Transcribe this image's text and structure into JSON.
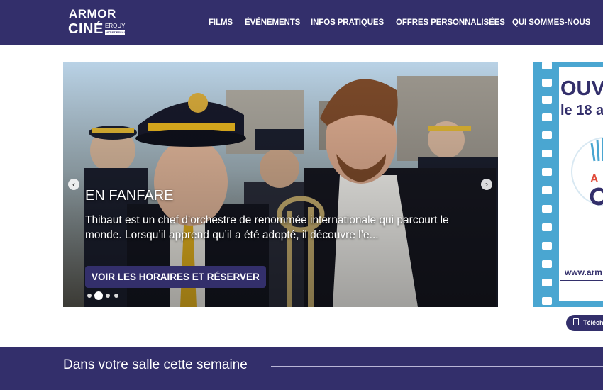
{
  "header": {
    "logo": {
      "line1": "ARMOR",
      "line2": "CINÉ",
      "line3": "ERQUY",
      "line4": "ART ET ESSAI"
    },
    "nav": [
      {
        "label": "FILMS"
      },
      {
        "label": "ÉVÉNEMENTS"
      },
      {
        "label": "INFOS PRATIQUES"
      },
      {
        "label": "OFFRES PERSONNALISÉES"
      },
      {
        "label": "QUI SOMMES-NOUS"
      }
    ],
    "colors": {
      "primary": "#332f6b",
      "accent": "#f4c430"
    }
  },
  "slider": {
    "title": "EN FANFARE",
    "description": "Thibaut est un chef d’orchestre de renommée internationale qui parcourt le monde. Lorsqu’il apprend qu’il a été adopté, il découvre l’e...",
    "cta": "VOIR LES HORAIRES ET RÉSERVER",
    "active_dot": 2,
    "dot_count": 4,
    "prev_icon": "chevron-left-icon",
    "next_icon": "chevron-right-icon"
  },
  "poster": {
    "title_partial": "OUV",
    "date_partial": "le 18 a",
    "url_partial": "www.arm",
    "color": "#4aa6d1"
  },
  "download_button": {
    "label": "Téléch",
    "icon": "bookmark-icon"
  },
  "section": {
    "title": "Dans votre salle cette semaine"
  }
}
